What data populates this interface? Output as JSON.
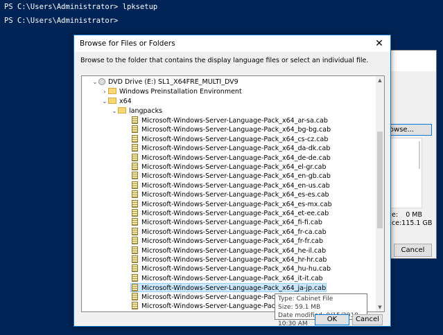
{
  "console": {
    "line1": "PS C:\\Users\\Administrator> lpksetup",
    "line2": "PS C:\\Users\\Administrator>"
  },
  "background_dialog": {
    "browse_label": "rowse...",
    "size1_label": "e:",
    "size1_value": "0 MB",
    "size2_label": "ce:",
    "size2_value": "115.1 GB",
    "cancel_label": "Cancel"
  },
  "dialog": {
    "title": "Browse for Files or Folders",
    "instruction": "Browse to the folder that contains the display language files or select an individual file.",
    "ok_label": "OK",
    "cancel_label": "Cancel",
    "tree": {
      "drive": "DVD Drive (E:) SL1_X64FRE_MULTI_DV9",
      "folders": [
        "Windows Preinstallation Environment",
        "x64",
        "langpacks"
      ],
      "files": [
        "Microsoft-Windows-Server-Language-Pack_x64_ar-sa.cab",
        "Microsoft-Windows-Server-Language-Pack_x64_bg-bg.cab",
        "Microsoft-Windows-Server-Language-Pack_x64_cs-cz.cab",
        "Microsoft-Windows-Server-Language-Pack_x64_da-dk.cab",
        "Microsoft-Windows-Server-Language-Pack_x64_de-de.cab",
        "Microsoft-Windows-Server-Language-Pack_x64_el-gr.cab",
        "Microsoft-Windows-Server-Language-Pack_x64_en-gb.cab",
        "Microsoft-Windows-Server-Language-Pack_x64_en-us.cab",
        "Microsoft-Windows-Server-Language-Pack_x64_es-es.cab",
        "Microsoft-Windows-Server-Language-Pack_x64_es-mx.cab",
        "Microsoft-Windows-Server-Language-Pack_x64_et-ee.cab",
        "Microsoft-Windows-Server-Language-Pack_x64_fi-fi.cab",
        "Microsoft-Windows-Server-Language-Pack_x64_fr-ca.cab",
        "Microsoft-Windows-Server-Language-Pack_x64_fr-fr.cab",
        "Microsoft-Windows-Server-Language-Pack_x64_he-il.cab",
        "Microsoft-Windows-Server-Language-Pack_x64_hr-hr.cab",
        "Microsoft-Windows-Server-Language-Pack_x64_hu-hu.cab",
        "Microsoft-Windows-Server-Language-Pack_x64_it-it.cab",
        "Microsoft-Windows-Server-Language-Pack_x64_ja-jp.cab",
        "Microsoft-Windows-Server-Language-Pack_x64_ko-kr.cab",
        "Microsoft-Windows-Server-Language-Pack_x64_lt-lt.cab"
      ],
      "selected_file": "Microsoft-Windows-Server-Language-Pack_x64_ja-jp.cab"
    },
    "tooltip": {
      "type": "Type: Cabinet File",
      "size": "Size: 59.1 MB",
      "modified": "Date modified: 9/15/2018 10:30 AM"
    }
  },
  "colors": {
    "console_bg": "#012456",
    "accent": "#0078d7",
    "selection": "#cce8ff"
  }
}
